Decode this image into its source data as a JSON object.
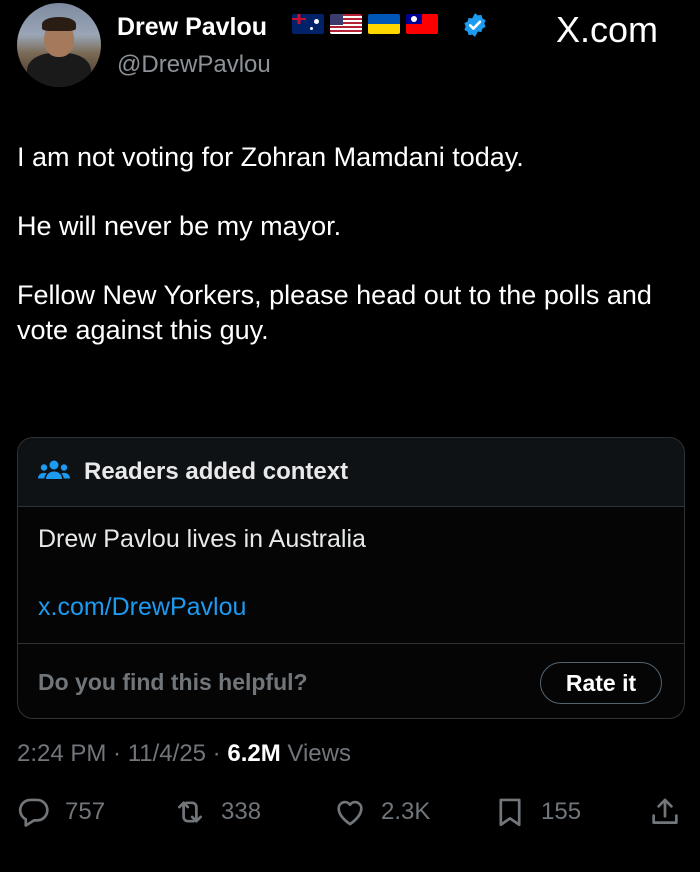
{
  "header": {
    "name": "Drew Pavlou",
    "handle": "@DrewPavlou",
    "flags": [
      "australia-flag",
      "usa-flag",
      "ukraine-flag",
      "taiwan-flag"
    ],
    "verified": true,
    "site_label": "X.com"
  },
  "tweet": {
    "paragraphs": [
      "I am not voting for Zohran Mamdani today.",
      "He will never be my mayor.",
      "Fellow New Yorkers, please head out to the polls and vote against this guy."
    ]
  },
  "community_note": {
    "title": "Readers added context",
    "text": "Drew Pavlou lives in Australia",
    "link": "x.com/DrewPavlou",
    "question": "Do you find this helpful?",
    "button": "Rate it"
  },
  "meta": {
    "time": "2:24 PM",
    "sep1": " · ",
    "date": "11/4/25",
    "sep2": " · ",
    "views_count": "6.2M",
    "views_label": " Views"
  },
  "actions": {
    "replies": "757",
    "reposts": "338",
    "likes": "2.3K",
    "bookmarks": "155"
  },
  "colors": {
    "background": "#000000",
    "accent": "#1d9bf0",
    "muted": "#71767b"
  }
}
